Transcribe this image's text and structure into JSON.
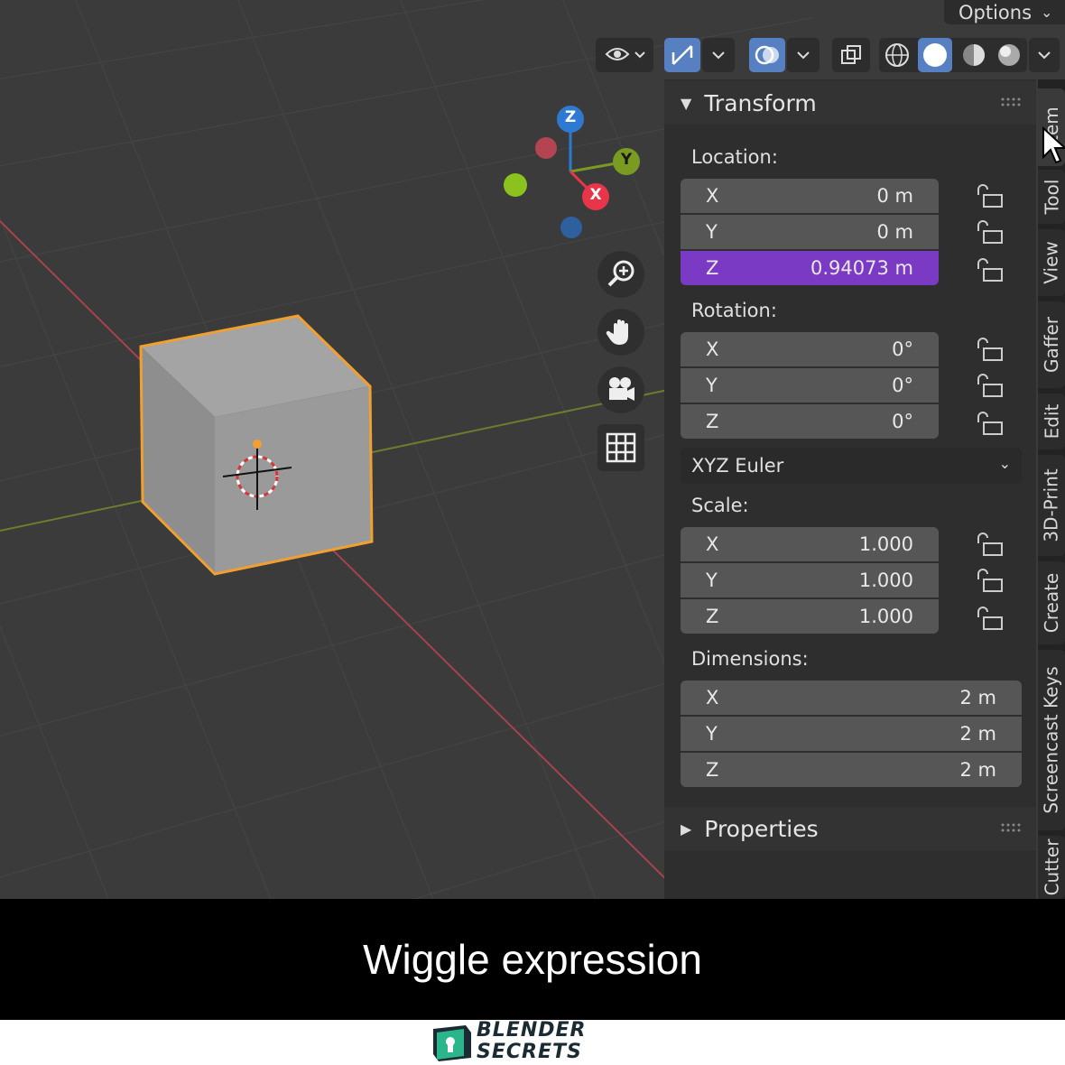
{
  "header": {
    "options_label": "Options"
  },
  "gizmo": {
    "axis_z": "Z",
    "axis_y": "Y",
    "axis_x": "X",
    "colors": {
      "x": "#e8354a",
      "y": "#7a9b22",
      "z": "#2e7ad3"
    }
  },
  "transform_panel": {
    "title": "Transform",
    "location": {
      "label": "Location:",
      "x": {
        "axis": "X",
        "value": "0 m"
      },
      "y": {
        "axis": "Y",
        "value": "0 m"
      },
      "z": {
        "axis": "Z",
        "value": "0.94073 m"
      }
    },
    "rotation": {
      "label": "Rotation:",
      "x": {
        "axis": "X",
        "value": "0°"
      },
      "y": {
        "axis": "Y",
        "value": "0°"
      },
      "z": {
        "axis": "Z",
        "value": "0°"
      },
      "mode": "XYZ Euler"
    },
    "scale": {
      "label": "Scale:",
      "x": {
        "axis": "X",
        "value": "1.000"
      },
      "y": {
        "axis": "Y",
        "value": "1.000"
      },
      "z": {
        "axis": "Z",
        "value": "1.000"
      }
    },
    "dimensions": {
      "label": "Dimensions:",
      "x": {
        "axis": "X",
        "value": "2 m"
      },
      "y": {
        "axis": "Y",
        "value": "2 m"
      },
      "z": {
        "axis": "Z",
        "value": "2 m"
      }
    }
  },
  "properties_panel": {
    "title": "Properties"
  },
  "tabs": [
    "Item",
    "Tool",
    "View",
    "Gaffer",
    "Edit",
    "3D-Print",
    "Create",
    "Screencast Keys",
    "Cutter"
  ],
  "caption": "Wiggle expression",
  "logo": {
    "line1": "BLENDER",
    "line2": "SECRETS"
  },
  "colors": {
    "active_field": "#7a3ac4",
    "selection_outline": "#f0a030",
    "accent": "#5680c2"
  }
}
